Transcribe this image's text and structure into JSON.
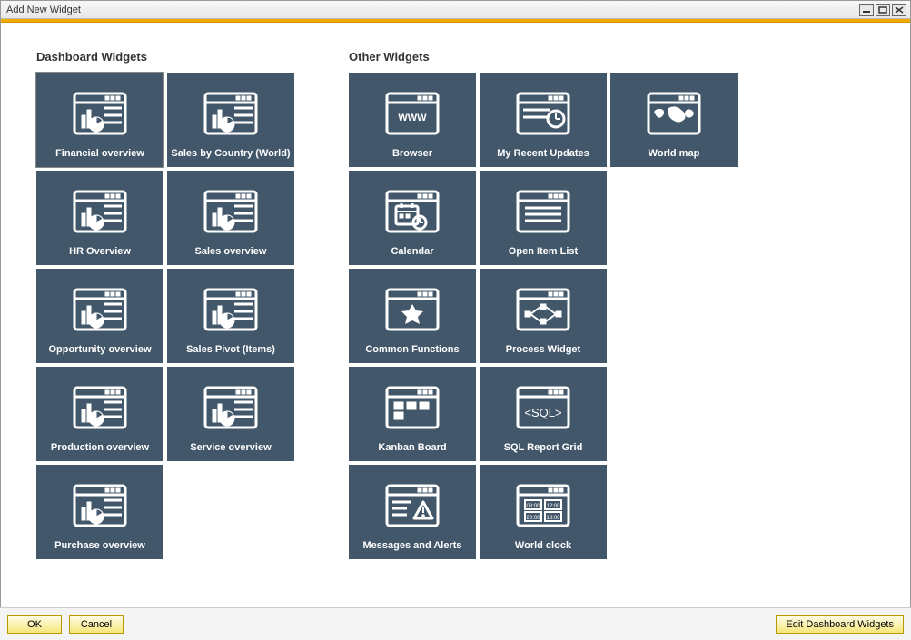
{
  "window": {
    "title": "Add New Widget"
  },
  "sections": {
    "dashboard": {
      "title": "Dashboard Widgets",
      "items": [
        {
          "label": "Financial overview"
        },
        {
          "label": "Sales by Country (World)"
        },
        {
          "label": "HR Overview"
        },
        {
          "label": "Sales overview"
        },
        {
          "label": "Opportunity overview"
        },
        {
          "label": "Sales Pivot (Items)"
        },
        {
          "label": "Production overview"
        },
        {
          "label": "Service overview"
        },
        {
          "label": "Purchase overview"
        }
      ]
    },
    "other": {
      "title": "Other Widgets",
      "items": [
        {
          "label": "Browser"
        },
        {
          "label": "My Recent Updates"
        },
        {
          "label": "World map"
        },
        {
          "label": "Calendar"
        },
        {
          "label": "Open Item List"
        },
        {
          "label": "Common Functions"
        },
        {
          "label": "Process Widget"
        },
        {
          "label": "Kanban Board"
        },
        {
          "label": "SQL Report Grid"
        },
        {
          "label": "Messages and Alerts"
        },
        {
          "label": "World clock"
        }
      ]
    }
  },
  "footer": {
    "ok": "OK",
    "cancel": "Cancel",
    "edit": "Edit Dashboard Widgets"
  }
}
